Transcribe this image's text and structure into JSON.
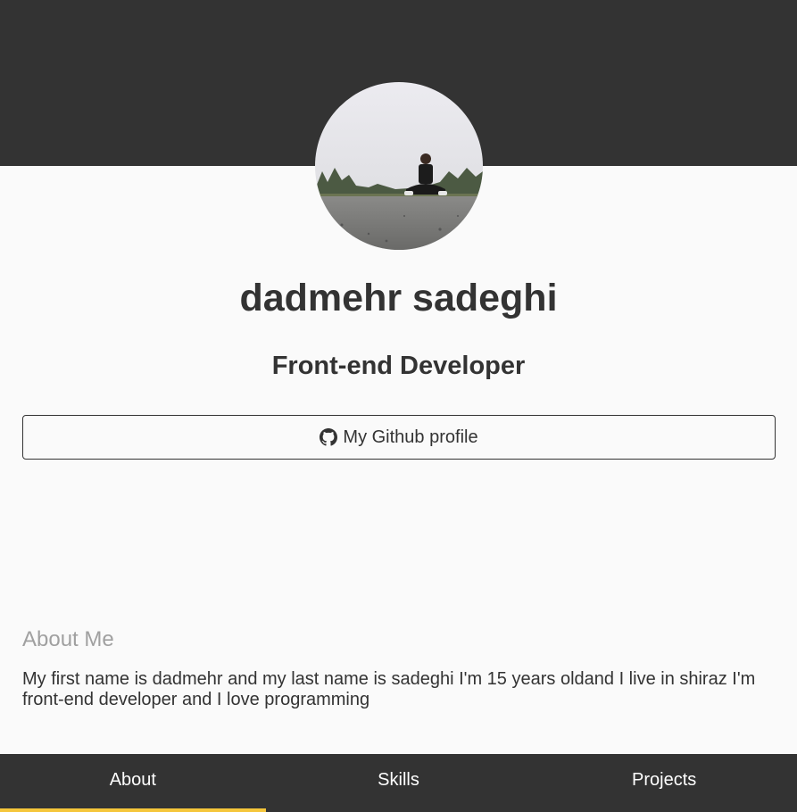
{
  "profile": {
    "name": "dadmehr sadeghi",
    "role": "Front-end Developer",
    "avatar_icon": "profile-photo"
  },
  "github_button": {
    "label": "My Github profile",
    "icon": "github-icon"
  },
  "about": {
    "title": "About Me",
    "text": "My first name is dadmehr and my last name is sadeghi I'm 15 years oldand I live in shiraz I'm front-end developer and I love programming"
  },
  "nav": {
    "tabs": [
      {
        "label": "About",
        "active": true
      },
      {
        "label": "Skills",
        "active": false
      },
      {
        "label": "Projects",
        "active": false
      }
    ]
  },
  "colors": {
    "header_bg": "#333333",
    "page_bg": "#fafafa",
    "accent": "#f5c63b",
    "muted_text": "#a0a0a0"
  }
}
